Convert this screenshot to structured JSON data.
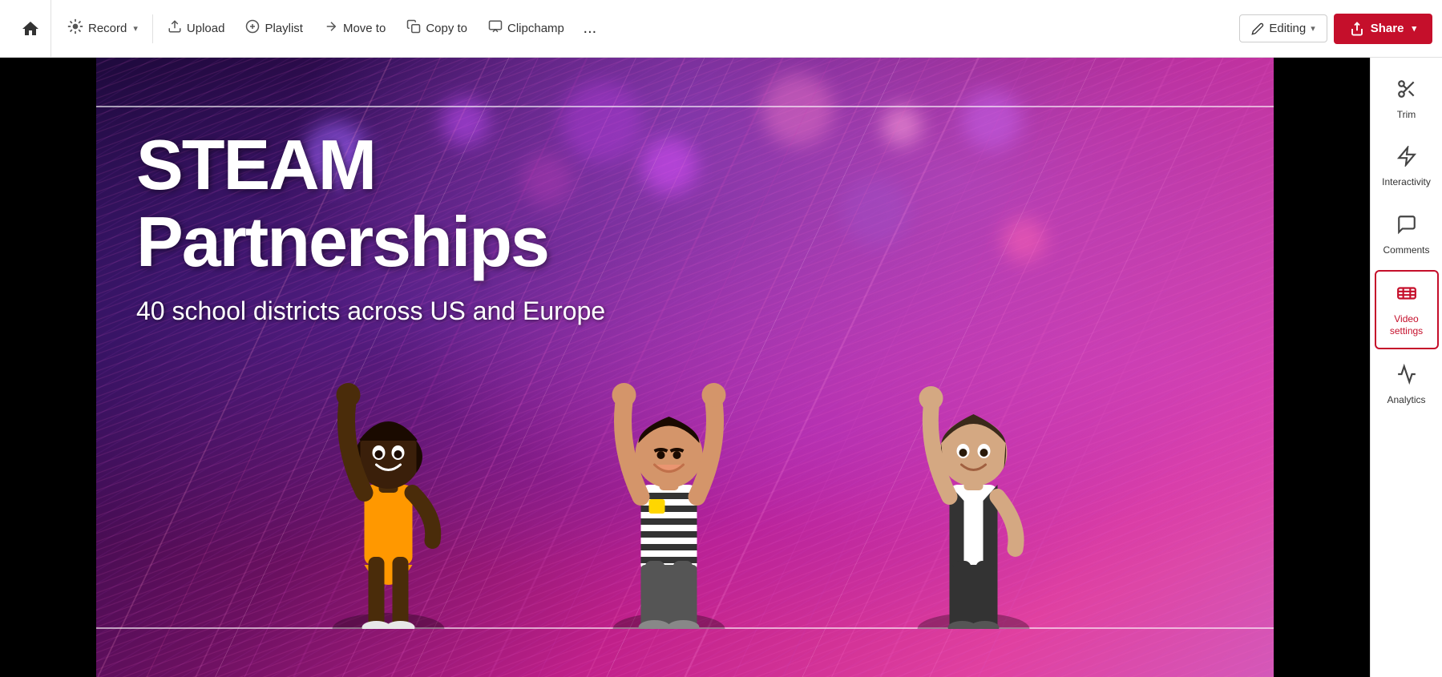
{
  "toolbar": {
    "home_label": "Home",
    "record_label": "Record",
    "upload_label": "Upload",
    "playlist_label": "Playlist",
    "move_to_label": "Move to",
    "copy_to_label": "Copy to",
    "clipchamp_label": "Clipchamp",
    "more_label": "...",
    "editing_label": "Editing",
    "share_label": "Share"
  },
  "video": {
    "title": "STEAM",
    "subtitle": "Partnerships",
    "description": "40 school districts across US and Europe"
  },
  "sidebar": {
    "trim_label": "Trim",
    "interactivity_label": "Interactivity",
    "comments_label": "Comments",
    "video_settings_label": "Video settings",
    "analytics_label": "Analytics"
  }
}
